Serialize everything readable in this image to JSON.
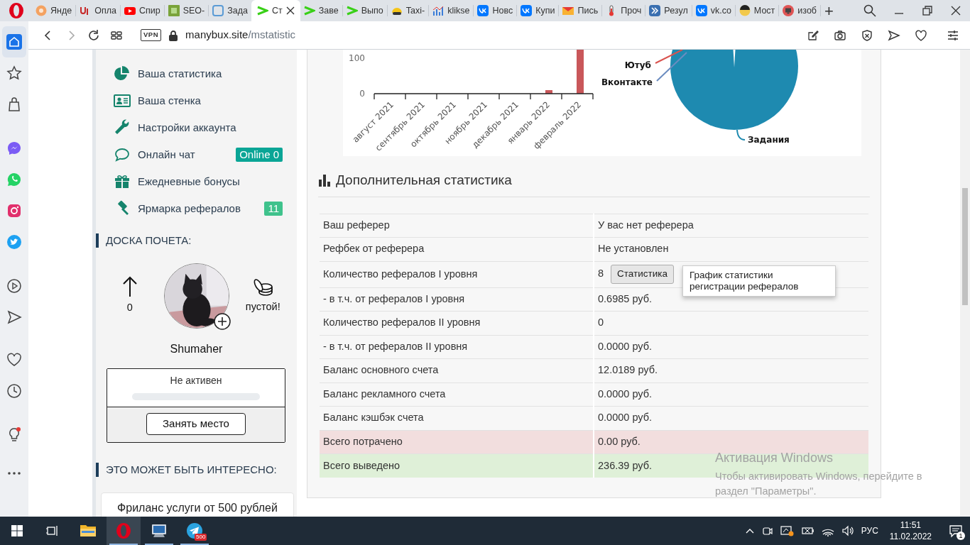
{
  "browser": {
    "tabs": [
      {
        "kind": "sun",
        "title": "Янде",
        "selected": false
      },
      {
        "kind": "hook",
        "title": "Опла",
        "selected": false
      },
      {
        "kind": "youtube",
        "title": "Спир",
        "selected": false
      },
      {
        "kind": "green-square",
        "title": "SEO-",
        "selected": false
      },
      {
        "kind": "blue-square",
        "title": "Зада",
        "selected": false
      },
      {
        "kind": "chevron",
        "title": "Ст",
        "selected": true
      },
      {
        "kind": "chevron",
        "title": "Заве",
        "selected": false
      },
      {
        "kind": "chevron",
        "title": "Выпо",
        "selected": false
      },
      {
        "kind": "taxi",
        "title": "Taxi-",
        "selected": false
      },
      {
        "kind": "bars",
        "title": "klikse",
        "selected": false
      },
      {
        "kind": "vk",
        "title": "Новс",
        "selected": false
      },
      {
        "kind": "vk",
        "title": "Купи",
        "selected": false
      },
      {
        "kind": "mail",
        "title": "Пись",
        "selected": false
      },
      {
        "kind": "thermometer",
        "title": "Проч",
        "selected": false
      },
      {
        "kind": "arrows",
        "title": "Резул",
        "selected": false
      },
      {
        "kind": "vk",
        "title": "vk.co",
        "selected": false
      },
      {
        "kind": "face",
        "title": "Мост",
        "selected": false
      },
      {
        "kind": "monitor",
        "title": "изоб",
        "selected": false
      }
    ],
    "new_tab": "+",
    "vpn": "VPN",
    "url_host": "manybux.site",
    "url_path": "/mstatistic"
  },
  "opera_sidebar": [
    {
      "kind": "home",
      "selected": true,
      "dot": false
    },
    {
      "kind": "star",
      "selected": false,
      "dot": false
    },
    {
      "kind": "bag",
      "selected": false,
      "dot": false
    },
    {
      "kind": "messenger",
      "selected": false,
      "dot": false
    },
    {
      "kind": "whatsapp",
      "selected": false,
      "dot": false
    },
    {
      "kind": "instagram",
      "selected": false,
      "dot": false
    },
    {
      "kind": "twitter",
      "selected": false,
      "dot": false
    },
    {
      "kind": "player",
      "selected": false,
      "dot": false
    },
    {
      "kind": "send",
      "selected": false,
      "dot": false
    },
    {
      "kind": "heart",
      "selected": false,
      "dot": false
    },
    {
      "kind": "clock",
      "selected": false,
      "dot": false
    },
    {
      "kind": "bulb",
      "selected": false,
      "dot": true
    },
    {
      "kind": "more",
      "selected": false,
      "dot": false
    }
  ],
  "sidebar": {
    "menu": [
      {
        "kind": "pie",
        "label": "Ваша статистика"
      },
      {
        "kind": "card",
        "label": "Ваша стенка"
      },
      {
        "kind": "wrench",
        "label": "Настройки аккаунта"
      },
      {
        "kind": "chat",
        "label": "Онлайн чат",
        "badge": {
          "text": "Online 0",
          "color": "#0aa596"
        }
      },
      {
        "kind": "gift",
        "label": "Ежедневные бонусы"
      },
      {
        "kind": "gavel",
        "label": "Ярмарка рефералов",
        "badge": {
          "text": "11",
          "color": "#3fc28c"
        }
      }
    ],
    "honor_board": {
      "title": "ДОСКА ПОЧЕТА:",
      "count": "0",
      "coins_label": "пустой!",
      "user": "Shumaher",
      "status": "Не активен",
      "level": 0,
      "button": "Занять место"
    },
    "interesting": {
      "title": "ЭТО МОЖЕТ БЫТЬ ИНТЕРЕСНО:",
      "card_title": "Фриланс услуги от 500 рублей"
    }
  },
  "charts": {
    "bar": {
      "chart_data": {
        "type": "bar",
        "categories": [
          "август 2021",
          "сентябрь 2021",
          "октябрь 2021",
          "ноябрь 2021",
          "декабрь 2021",
          "январь 2022",
          "февраль 2022"
        ],
        "values": [
          0,
          0,
          0,
          0,
          0,
          10,
          124
        ],
        "ylim": [
          0,
          124
        ],
        "yticks": [
          0,
          100
        ]
      }
    },
    "pie": {
      "labels": [
        {
          "text": "Ютуб",
          "color": "#d9534f"
        },
        {
          "text": "Вконтакте",
          "color": "#6b8cc0"
        },
        {
          "text": "Задания",
          "color": "#1e8ab0"
        }
      ]
    }
  },
  "stats": {
    "title": "Дополнительная статистика",
    "rows": [
      {
        "kind": "plain",
        "label": "Ваш реферер",
        "value": "У вас нет реферера"
      },
      {
        "kind": "plain",
        "label": "Рефбек от реферера",
        "value": "Не установлен"
      },
      {
        "kind": "plain",
        "label": "Количество рефералов I уровня",
        "value": "8",
        "button": "Статистика",
        "tooltip": "График статистики регистрации рефералов"
      },
      {
        "kind": "plain",
        "label": "- в т.ч. от рефералов I уровня",
        "value": "0.6985 руб."
      },
      {
        "kind": "plain",
        "label": "Количество рефералов II уровня",
        "value": "0"
      },
      {
        "kind": "plain",
        "label": "- в т.ч. от рефералов II уровня",
        "value": "0.0000 руб."
      },
      {
        "kind": "plain",
        "label": "Баланс основного счета",
        "value": "12.0189 руб."
      },
      {
        "kind": "plain",
        "label": "Баланс рекламного счета",
        "value": "0.0000 руб."
      },
      {
        "kind": "plain",
        "label": "Баланс кэшбэк счета",
        "value": "0.0000 руб."
      },
      {
        "kind": "danger",
        "label": "Всего потрачено",
        "value": "0.00 руб."
      },
      {
        "kind": "success",
        "label": "Всего выведено",
        "value": "236.39 руб."
      }
    ]
  },
  "windows_activation": {
    "title": "Активация Windows",
    "text": "Чтобы активировать Windows, перейдите в раздел \"Параметры\"."
  },
  "taskbar": {
    "apps": [
      {
        "kind": "explorer",
        "selected": false,
        "running": false
      },
      {
        "kind": "opera",
        "selected": true,
        "running": true
      },
      {
        "kind": "computer",
        "selected": false,
        "running": true
      },
      {
        "kind": "telegram",
        "selected": false,
        "running": true,
        "badge": "500"
      }
    ],
    "language": "РУС",
    "time": "11:51",
    "date": "11.02.2022",
    "notifications": "1"
  }
}
